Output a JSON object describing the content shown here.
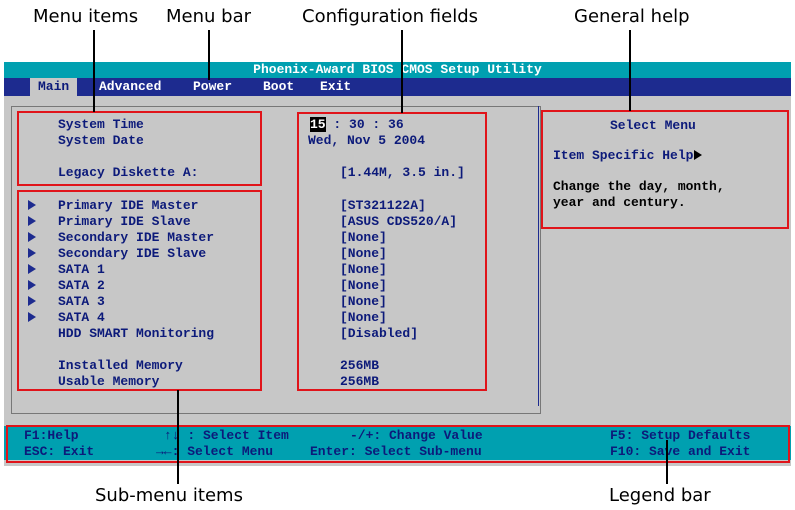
{
  "callouts": {
    "menu_items": "Menu items",
    "menu_bar": "Menu bar",
    "config_fields": "Configuration fields",
    "general_help": "General help",
    "submenu_items": "Sub-menu items",
    "legend_bar": "Legend bar"
  },
  "title": "Phoenix-Award BIOS CMOS Setup Utility",
  "menu": [
    "Main",
    "Advanced",
    "Power",
    "Boot",
    "Exit"
  ],
  "items": {
    "system_time": {
      "label": "System Time",
      "hour": "15",
      "rest": " : 30 : 36"
    },
    "system_date": {
      "label": "System Date",
      "value": "Wed, Nov 5 2004"
    },
    "legacy": {
      "label": "Legacy Diskette A:",
      "value": "[1.44M, 3.5 in.]"
    }
  },
  "submenus": [
    {
      "label": "Primary IDE Master",
      "value": "[ST321122A]"
    },
    {
      "label": "Primary IDE Slave",
      "value": "[ASUS CDS520/A]"
    },
    {
      "label": "Secondary IDE Master",
      "value": "[None]"
    },
    {
      "label": "Secondary IDE Slave",
      "value": "[None]"
    },
    {
      "label": "SATA 1",
      "value": "[None]"
    },
    {
      "label": "SATA 2",
      "value": "[None]"
    },
    {
      "label": "SATA 3",
      "value": "[None]"
    },
    {
      "label": "SATA 4",
      "value": "[None]"
    }
  ],
  "hdd_smart": {
    "label": "HDD SMART Monitoring",
    "value": "[Disabled]"
  },
  "memory": {
    "installed": {
      "label": "Installed Memory",
      "value": "256MB"
    },
    "usable": {
      "label": "Usable Memory",
      "value": "256MB"
    }
  },
  "help": {
    "header": "Select Menu",
    "specific": "Item Specific Help",
    "line1": "Change the day, month,",
    "line2": "year and century."
  },
  "legend": {
    "f1": "F1:Help",
    "esc": "ESC: Exit",
    "select_item": "↑↓ : Select Item",
    "select_menu": "→←: Select Menu",
    "change": "-/+: Change Value",
    "enter": "Enter: Select Sub-menu",
    "f5": "F5: Setup Defaults",
    "f10": "F10: Save and Exit"
  },
  "colors": {
    "bios_bg": "#c7c7c7",
    "menubar": "#1d2b8f",
    "titlebar": "#00a0b0",
    "text": "#0c1a7a",
    "callout_box": "#e0141a"
  }
}
